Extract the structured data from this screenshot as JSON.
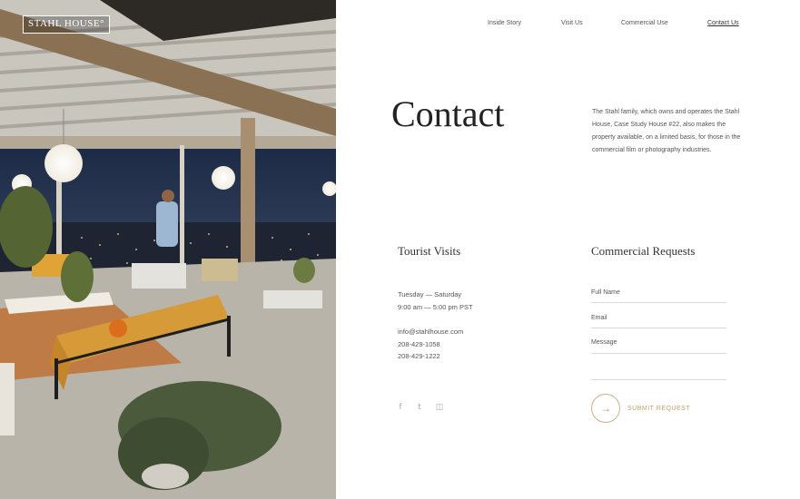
{
  "brand": {
    "logo_text": "STAHL HOUSE°"
  },
  "nav": {
    "items": [
      {
        "label": "Inside Story"
      },
      {
        "label": "Visit Us"
      },
      {
        "label": "Commercial Use"
      },
      {
        "label": "Contact Us",
        "active": true
      }
    ]
  },
  "page": {
    "title": "Contact",
    "intro": "The Stahl family, which owns and operates the Stahl House, Case Study House #22, also makes the property available, on a limited basis, for those in the commercial film or photography industries."
  },
  "tourist": {
    "heading": "Tourist Visits",
    "days": "Tuesday — Saturday",
    "hours": "9:00 am — 5:00 pm PST",
    "email": "info@stahlhouse.com",
    "phone1": "208-429-1058",
    "phone2": "208-429-1222"
  },
  "social": [
    {
      "icon": "facebook-icon",
      "glyph": "f"
    },
    {
      "icon": "twitter-icon",
      "glyph": "t"
    },
    {
      "icon": "instagram-icon",
      "glyph": "◫"
    }
  ],
  "form": {
    "heading": "Commercial Requests",
    "full_name_label": "Full Name",
    "email_label": "Email",
    "message_label": "Message",
    "submit_label": "SUBMIT REQUEST",
    "submit_icon": "→"
  },
  "colors": {
    "accent": "#c4a06a",
    "text": "#333333",
    "muted": "#555555"
  }
}
